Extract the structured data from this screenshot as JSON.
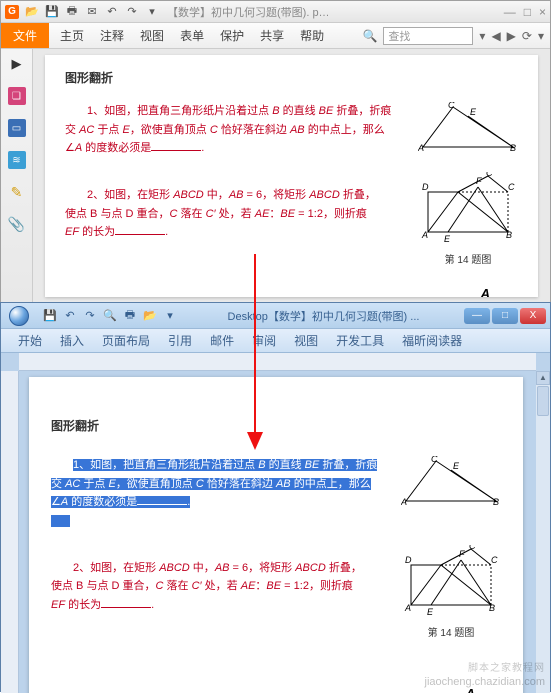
{
  "foxit": {
    "logo": "G",
    "title": "【数学】初中几何习题(带图). p…",
    "qat_icons": [
      "open",
      "save",
      "print",
      "email",
      "undo",
      "redo",
      "sep"
    ],
    "winbtns": {
      "min": "—",
      "max": "□",
      "close": "×"
    },
    "file_tab": "文件",
    "tabs": [
      "主页",
      "注释",
      "视图",
      "表单",
      "保护",
      "共享",
      "帮助"
    ],
    "tool_icons": [
      "zoom-in"
    ],
    "search_placeholder": "查找",
    "search_dd": "▾",
    "overflow_icons": [
      "←",
      "→",
      "⟳",
      "▾"
    ],
    "side": {
      "arrow": "▶",
      "bookmark": "❏",
      "pages": "▭",
      "layers": "≋",
      "sig": "✎",
      "clip": "📎"
    }
  },
  "word": {
    "title": "Desktop【数学】初中几何习题(带图) ...",
    "qat_icons": [
      "save",
      "undo",
      "redo",
      "zoom",
      "print",
      "open",
      "sep"
    ],
    "tabs": [
      "开始",
      "插入",
      "页面布局",
      "引用",
      "邮件",
      "审阅",
      "视图",
      "开发工具",
      "福昕阅读器"
    ],
    "winbtns": {
      "min": "—",
      "max": "□",
      "close": "X"
    }
  },
  "doc": {
    "section_title": "图形翻折",
    "p1": {
      "line1_a": "1、如图，把直角三角形纸片沿着过点 ",
      "b": "B",
      "line1_b": " 的直线 ",
      "be": "BE",
      "line1_c": " 折叠，折痕",
      "line2_a": "交 ",
      "ac": "AC",
      "line2_b": " 于点 ",
      "e": "E",
      "line2_c": "，欲使直角顶点 ",
      "c": "C",
      "line2_d": " 恰好落在斜边 ",
      "ab": "AB",
      "line2_e": " 的中点上，那么",
      "line3_a": "∠",
      "a": "A",
      "line3_b": " 的度数必须是",
      "period": "."
    },
    "p2": {
      "line1_a": "2、如图，在矩形 ",
      "abcd": "ABCD",
      "line1_b": " 中，",
      "ab": "AB",
      "eq": " = 6",
      "line1_c": "，将矩形 ",
      "abcd2": "ABCD",
      "line1_d": " 折叠，",
      "line2_a": "使点 B 与点 D 重合，",
      "c": "C",
      "line2_b": " 落在 ",
      "cprime": "C′",
      "line2_c": " 处，若 ",
      "ae": "AE",
      "colon": "：",
      "be2": "BE",
      "ratio": " = 1:2",
      "line2_d": "，则折痕",
      "line3_a": "EF",
      "line3_b": " 的长为",
      "period": "."
    },
    "fig1_labels": {
      "A": "A",
      "B": "B",
      "C": "C",
      "E": "E"
    },
    "fig2_labels": {
      "A": "A",
      "B": "B",
      "C": "C",
      "D": "D",
      "E": "E",
      "F": "F",
      "Cp": "C′"
    },
    "fig2_caption": "第 14 题图",
    "trailing_A": "A"
  },
  "watermark1": "脚本之家教程网",
  "watermark2": "jiaocheng.chazidian.com"
}
